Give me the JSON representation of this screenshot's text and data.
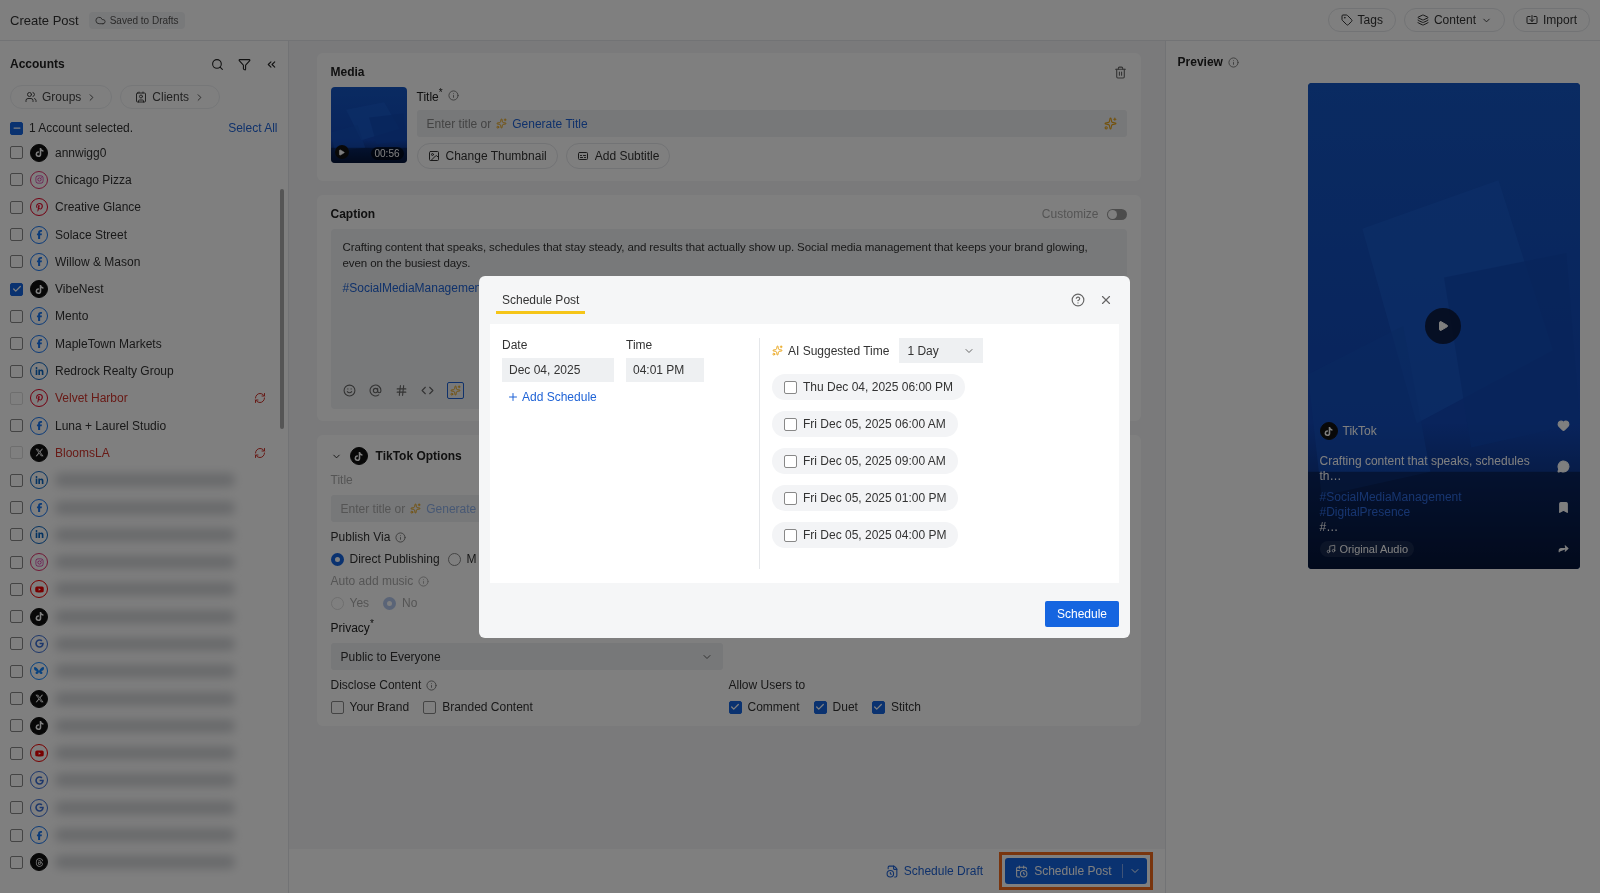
{
  "header": {
    "title": "Create Post",
    "save_status": "Saved to Drafts",
    "actions": [
      {
        "label": "Tags",
        "dropdown": false
      },
      {
        "label": "Content",
        "dropdown": true
      },
      {
        "label": "Import",
        "dropdown": false
      }
    ]
  },
  "accounts": {
    "title": "Accounts",
    "filters": [
      "Groups",
      "Clients"
    ],
    "selection": {
      "label": "1 Account selected.",
      "partial": true,
      "link": "Select All"
    },
    "items": [
      {
        "name": "annwigg0",
        "kind": "tiktok",
        "checked": false,
        "error": false
      },
      {
        "name": "Chicago Pizza",
        "kind": "instagram",
        "checked": false,
        "error": false
      },
      {
        "name": "Creative Glance",
        "kind": "pinterest",
        "checked": false,
        "error": false
      },
      {
        "name": "Solace Street",
        "kind": "facebook",
        "checked": false,
        "error": false
      },
      {
        "name": "Willow & Mason",
        "kind": "facebook",
        "checked": false,
        "error": false
      },
      {
        "name": "VibeNest",
        "kind": "tiktok",
        "checked": true,
        "error": false
      },
      {
        "name": "Mento",
        "kind": "facebook",
        "checked": false,
        "error": false
      },
      {
        "name": "MapleTown Markets",
        "kind": "facebook",
        "checked": false,
        "error": false
      },
      {
        "name": "Redrock Realty Group",
        "kind": "linkedin",
        "checked": false,
        "error": false
      },
      {
        "name": "Velvet Harbor",
        "kind": "pinterest",
        "checked": false,
        "error": true
      },
      {
        "name": "Luna + Laurel Studio",
        "kind": "facebook",
        "checked": false,
        "error": false
      },
      {
        "name": "BloomsLA",
        "kind": "x",
        "checked": false,
        "error": true
      },
      {
        "kind": "linkedin",
        "checked": false,
        "error": false
      },
      {
        "kind": "facebook",
        "checked": false,
        "error": false
      },
      {
        "kind": "linkedin",
        "checked": false,
        "error": false
      },
      {
        "kind": "instagram",
        "checked": false,
        "error": false
      },
      {
        "kind": "youtube",
        "checked": false,
        "error": false
      },
      {
        "kind": "tiktok",
        "checked": false,
        "error": false
      },
      {
        "kind": "google",
        "checked": false,
        "error": false
      },
      {
        "kind": "bluesky",
        "checked": false,
        "error": false
      },
      {
        "kind": "x",
        "checked": false,
        "error": false
      },
      {
        "kind": "tiktok",
        "checked": false,
        "error": false
      },
      {
        "kind": "youtube",
        "checked": false,
        "error": false
      },
      {
        "kind": "google",
        "checked": false,
        "error": false
      },
      {
        "kind": "google",
        "checked": false,
        "error": false
      },
      {
        "kind": "facebook",
        "checked": false,
        "error": false
      },
      {
        "kind": "threads",
        "checked": false,
        "error": false
      }
    ]
  },
  "media": {
    "title": "Media",
    "duration": "00:56",
    "title_label": "Title$^{*}$",
    "placeholder": "Enter title or",
    "generate": "Generate Title",
    "buttons": [
      "Change Thumbnail",
      "Add Subtitle"
    ]
  },
  "caption": {
    "title": "Caption",
    "customize": {
      "label": "Customize",
      "on": false
    },
    "text": "Crafting content that speaks, schedules that stay steady, and results that actually show up. Social media management that keeps your brand glowing, even on the busiest days.",
    "hashtags": "#SocialMediaManagemen"
  },
  "tiktok_options": {
    "title": "TikTok Options",
    "expanded": true,
    "title_label": "Title",
    "placeholder": "Enter title or",
    "generate": "Generate",
    "publish_via": {
      "label": "Publish Via",
      "options": [
        {
          "label": "Direct Publishing",
          "selected": true
        },
        {
          "label": "M",
          "selected": false
        }
      ]
    },
    "auto_music": {
      "label": "Auto add music",
      "disabled": true,
      "options": [
        {
          "label": "Yes",
          "selected": false
        },
        {
          "label": "No",
          "selected": true
        }
      ]
    },
    "privacy": {
      "label": "Privacy$^{*}$",
      "value": "Public to Everyone"
    },
    "disclose": {
      "label": "Disclose Content",
      "options": [
        {
          "label": "Your Brand",
          "checked": false
        },
        {
          "label": "Branded Content",
          "checked": false
        }
      ]
    },
    "allow": {
      "label": "Allow Users to",
      "options": [
        {
          "label": "Comment",
          "checked": true
        },
        {
          "label": "Duet",
          "checked": true
        },
        {
          "label": "Stitch",
          "checked": true
        }
      ]
    }
  },
  "footer": {
    "draft": "Schedule Draft",
    "primary": "Schedule Post",
    "highlighted": true
  },
  "preview": {
    "title": "Preview",
    "account": "TikTok",
    "caption": "Crafting content that speaks, schedules th…",
    "hashtags": [
      "#SocialMediaManagement",
      "#DigitalPresence"
    ],
    "more": "#…",
    "audio": "Original Audio"
  },
  "modal": {
    "tab": "Schedule Post",
    "date_label": "Date",
    "date": "Dec 04, 2025",
    "time_label": "Time",
    "time": "04:01 PM",
    "add": "Add Schedule",
    "ai_label": "AI Suggested Time",
    "range": "1 Day",
    "suggestions": [
      {
        "label": "Thu Dec 04, 2025 06:00 PM",
        "checked": false
      },
      {
        "label": "Fri Dec 05, 2025 06:00 AM",
        "checked": false
      },
      {
        "label": "Fri Dec 05, 2025 09:00 AM",
        "checked": false
      },
      {
        "label": "Fri Dec 05, 2025 01:00 PM",
        "checked": false
      },
      {
        "label": "Fri Dec 05, 2025 04:00 PM",
        "checked": false
      }
    ],
    "submit": "Schedule"
  }
}
